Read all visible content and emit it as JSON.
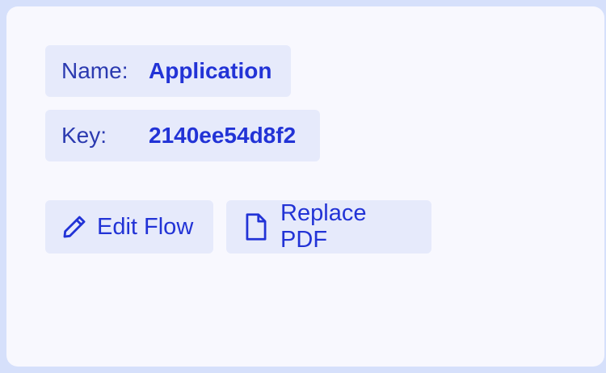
{
  "details": {
    "name_label": "Name:",
    "name_value": "Application",
    "key_label": "Key:",
    "key_value": "2140ee54d8f2"
  },
  "actions": {
    "edit_flow_label": "Edit Flow",
    "edit_flow_icon": "pencil-icon",
    "replace_pdf_label": "Replace PDF",
    "replace_pdf_icon": "document-icon"
  },
  "colors": {
    "page_background": "#d6e0fb",
    "card_background": "#f8f8fe",
    "chip_background": "#e6eafb",
    "accent": "#2233d6"
  }
}
